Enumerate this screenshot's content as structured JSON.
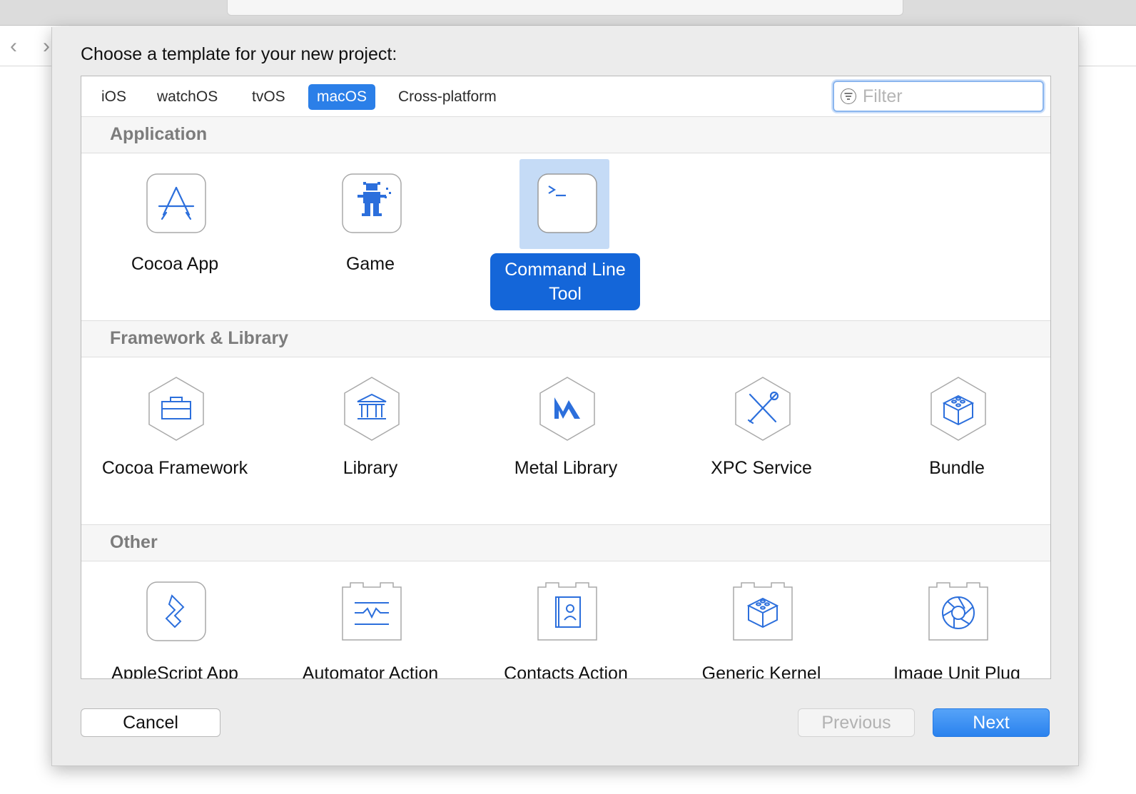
{
  "dialog": {
    "title": "Choose a template for your new project:"
  },
  "tabs": [
    {
      "label": "iOS",
      "selected": false
    },
    {
      "label": "watchOS",
      "selected": false
    },
    {
      "label": "tvOS",
      "selected": false
    },
    {
      "label": "macOS",
      "selected": true
    },
    {
      "label": "Cross-platform",
      "selected": false
    }
  ],
  "filter": {
    "placeholder": "Filter",
    "value": ""
  },
  "sections": [
    {
      "title": "Application",
      "templates": [
        {
          "label": "Cocoa App",
          "icon": "app-store-icon"
        },
        {
          "label": "Game",
          "icon": "game-sprite-icon"
        },
        {
          "label": "Command Line Tool",
          "icon": "terminal-icon",
          "selected": true
        }
      ]
    },
    {
      "title": "Framework & Library",
      "templates": [
        {
          "label": "Cocoa Framework",
          "icon": "toolbox-icon"
        },
        {
          "label": "Library",
          "icon": "building-columns-icon"
        },
        {
          "label": "Metal Library",
          "icon": "metal-icon"
        },
        {
          "label": "XPC Service",
          "icon": "tools-icon"
        },
        {
          "label": "Bundle",
          "icon": "lego-block-icon"
        }
      ]
    },
    {
      "title": "Other",
      "templates": [
        {
          "label": "AppleScript App",
          "icon": "script-icon"
        },
        {
          "label": "Automator Action",
          "icon": "automator-icon"
        },
        {
          "label": "Contacts Action",
          "icon": "contacts-icon"
        },
        {
          "label": "Generic Kernel",
          "icon": "kernel-block-icon"
        },
        {
          "label": "Image Unit Plug",
          "icon": "aperture-icon"
        }
      ]
    }
  ],
  "buttons": {
    "cancel": "Cancel",
    "previous": "Previous",
    "next": "Next"
  },
  "colors": {
    "accent": "#2b7fe8",
    "icon_blue": "#2c6fdc",
    "selection": "#1466d9",
    "selected_tile_bg": "#c5dbf6"
  }
}
